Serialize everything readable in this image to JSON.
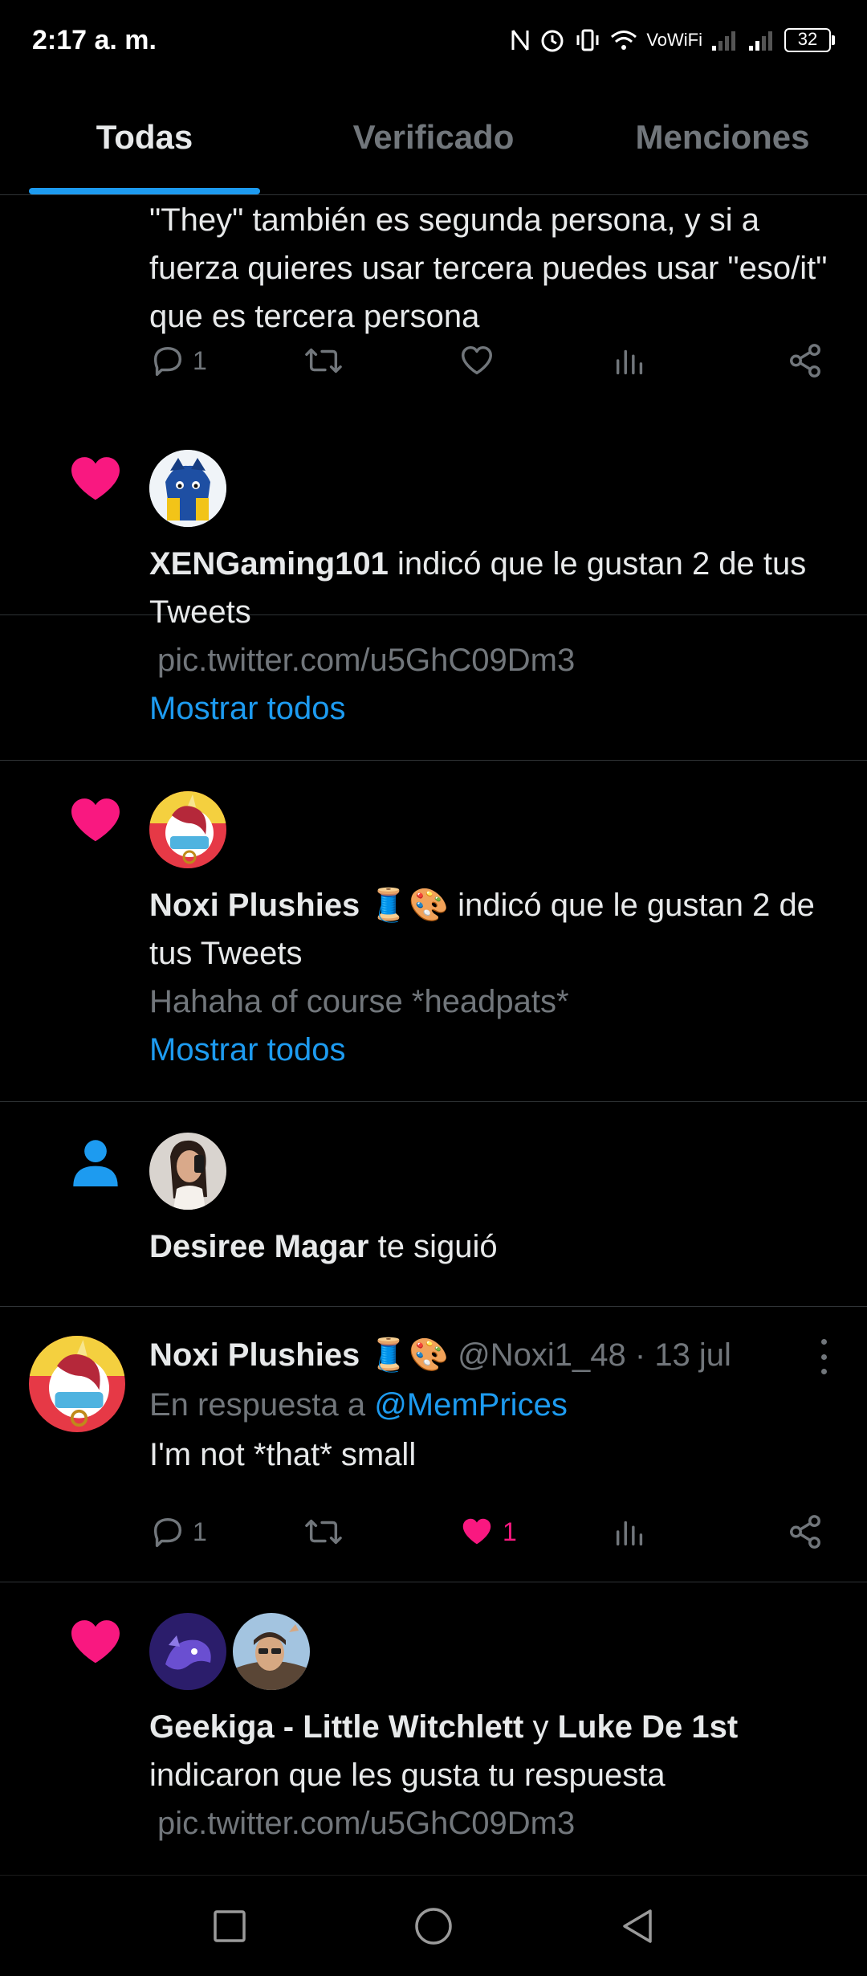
{
  "status_bar": {
    "time": "2:17 a. m.",
    "wifi_label": "VoWiFi",
    "battery": "32"
  },
  "tabs": [
    {
      "label": "Todas",
      "active": true
    },
    {
      "label": "Verificado",
      "active": false
    },
    {
      "label": "Menciones",
      "active": false
    }
  ],
  "feed": {
    "item1": {
      "text": "\"They\" también es segunda persona, y si a fuerza quieres usar tercera puedes usar \"eso/it\" que es tercera persona",
      "reply_count": "1"
    },
    "item2": {
      "name": "XENGaming101",
      "action_text": " indicó que le gustan 2 de tus Tweets",
      "preview": "pic.twitter.com/u5GhC09Dm3",
      "show_all": "Mostrar todos"
    },
    "item3": {
      "name": "Noxi Plushies 🧵🎨",
      "action_text": " indicó que le gustan 2 de tus Tweets",
      "preview": "Hahaha of course *headpats*",
      "show_all": "Mostrar todos"
    },
    "item4": {
      "name": "Desiree Magar",
      "action_text": " te siguió"
    },
    "item5": {
      "name": "Noxi Plushies 🧵🎨",
      "handle": " @Noxi1_48",
      "date": " · 13 jul",
      "reply_prefix": "En respuesta a ",
      "reply_to": "@MemPrices",
      "text": "I'm not *that* small",
      "reply_count": "1",
      "like_count": "1"
    },
    "item6": {
      "name1": "Geekiga - Little Witchlett",
      "joiner": " y ",
      "name2": "Luke De 1st",
      "action_text": "indicaron que les gusta tu respuesta",
      "preview": "pic.twitter.com/u5GhC09Dm3"
    }
  },
  "colors": {
    "accent": "#1d9bf0",
    "like": "#f91880",
    "muted": "#71767b",
    "text": "#e7e9ea",
    "divider": "#2f3336"
  }
}
